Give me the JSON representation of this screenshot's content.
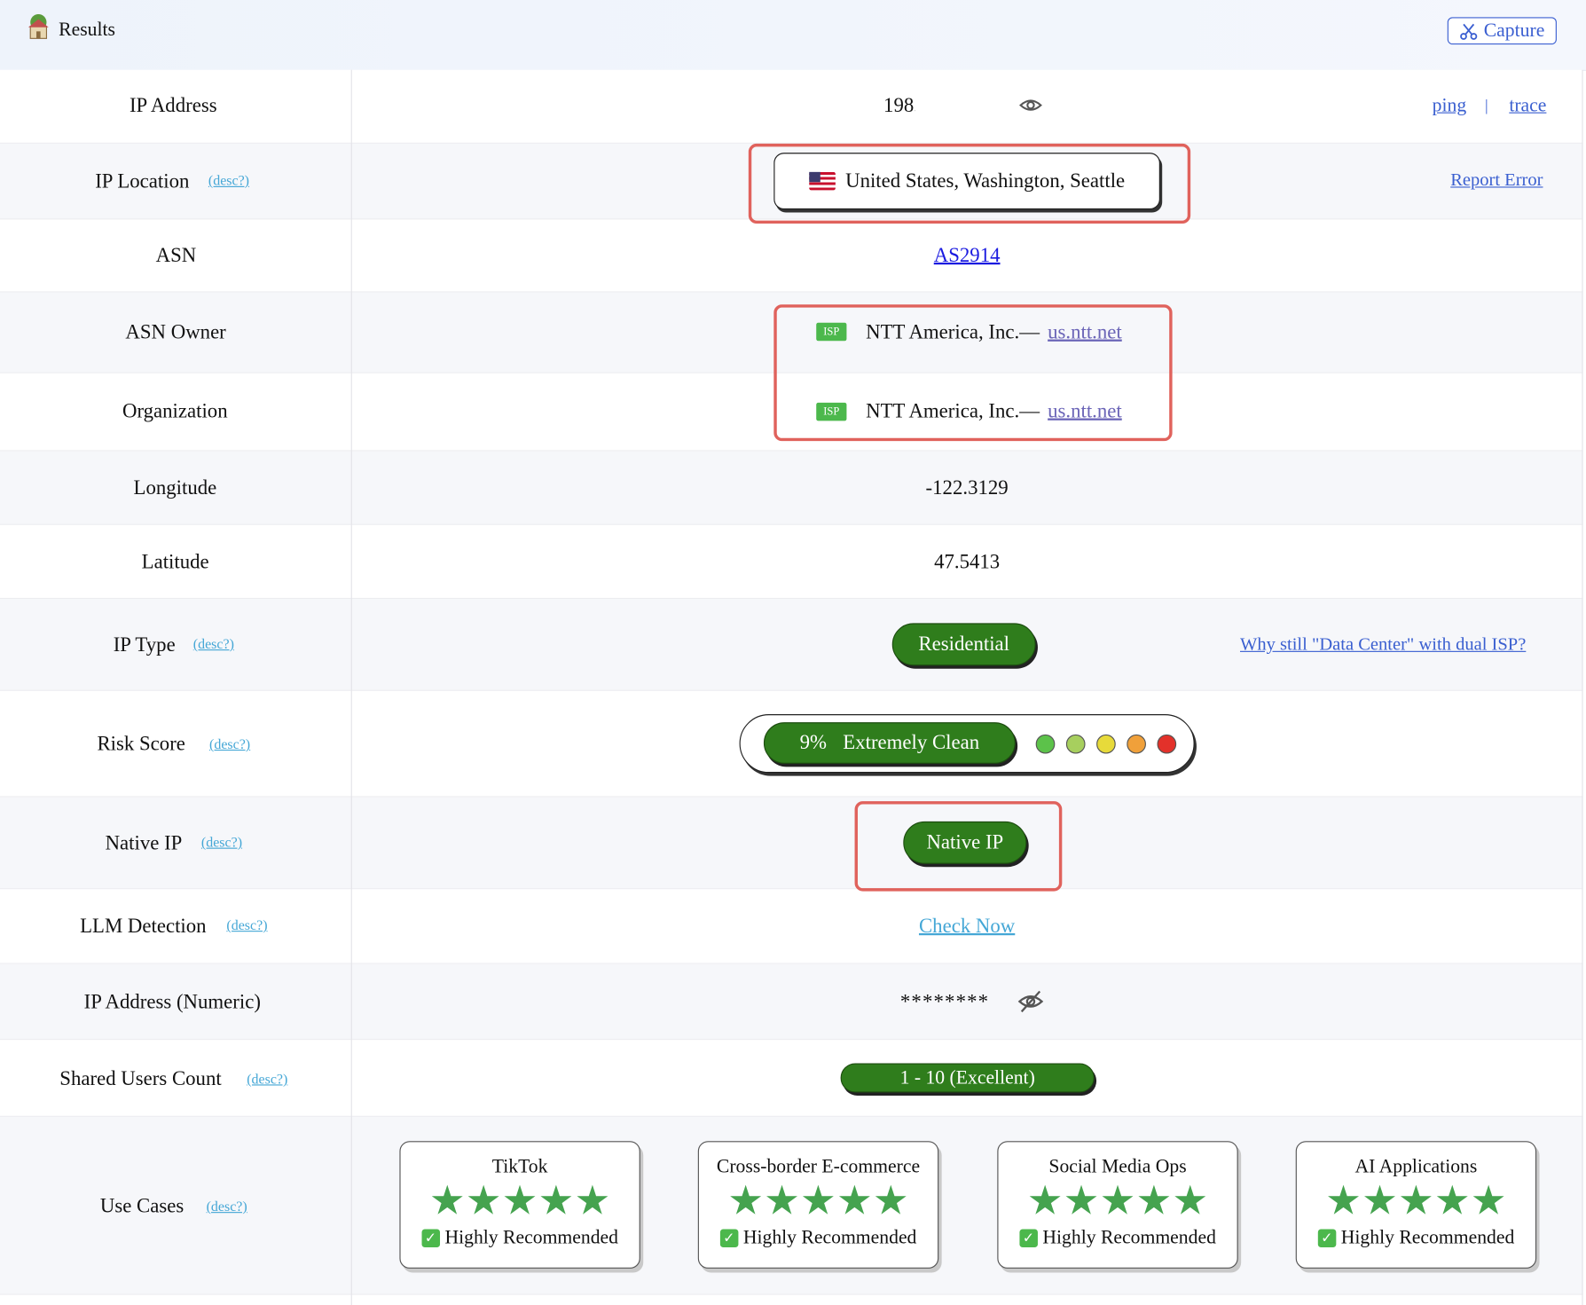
{
  "header": {
    "title": "Results",
    "capture_label": "Capture"
  },
  "rows": {
    "ip_address": {
      "label": "IP Address",
      "value": "198.",
      "ping": "ping",
      "separator": "|",
      "trace": "trace"
    },
    "ip_location": {
      "label": "IP Location",
      "desc": "(desc?)",
      "value": "United States, Washington, Seattle",
      "report": "Report Error"
    },
    "asn": {
      "label": "ASN",
      "value": "AS2914"
    },
    "asn_owner": {
      "label": "ASN Owner",
      "badge": "ISP",
      "value": "NTT America, Inc.—",
      "site": "us.ntt.net"
    },
    "organization": {
      "label": "Organization",
      "badge": "ISP",
      "value": "NTT America, Inc.—",
      "site": "us.ntt.net"
    },
    "longitude": {
      "label": "Longitude",
      "value": "-122.3129"
    },
    "latitude": {
      "label": "Latitude",
      "value": "47.5413"
    },
    "ip_type": {
      "label": "IP Type",
      "desc": "(desc?)",
      "value": "Residential",
      "help": "Why still \"Data Center\" with dual ISP?"
    },
    "risk_score": {
      "label": "Risk Score",
      "desc": "(desc?)",
      "percent": "9%",
      "value": "Extremely Clean",
      "level_colors": [
        "#5cc24a",
        "#a7cf5e",
        "#e7da3a",
        "#f0a03a",
        "#e3312a"
      ]
    },
    "native_ip": {
      "label": "Native IP",
      "desc": "(desc?)",
      "value": "Native IP"
    },
    "llm_detection": {
      "label": "LLM Detection",
      "desc": "(desc?)",
      "value": "Check Now"
    },
    "ip_numeric": {
      "label": "IP Address (Numeric)",
      "value": "********"
    },
    "shared_users": {
      "label": "Shared Users Count",
      "desc": "(desc?)",
      "value": "1 - 10 (Excellent)"
    },
    "use_cases": {
      "label": "Use Cases",
      "desc": "(desc?)",
      "cards": [
        {
          "title": "TikTok",
          "stars": "★★★★★",
          "rating": 5,
          "rec": "Highly Recommended"
        },
        {
          "title": "Cross-border E-commerce",
          "stars": "★★★★★",
          "rating": 5,
          "rec": "Highly Recommended"
        },
        {
          "title": "Social Media Ops",
          "stars": "★★★★★",
          "rating": 5,
          "rec": "Highly Recommended"
        },
        {
          "title": "AI Applications",
          "stars": "★★★★★",
          "rating": 5,
          "rec": "Highly Recommended"
        }
      ]
    }
  },
  "colors": {
    "accent_blue": "#3a5fd0",
    "link_cyan": "#45a7d6",
    "green": "#2f7d1c",
    "highlight_red": "#e0625c"
  }
}
